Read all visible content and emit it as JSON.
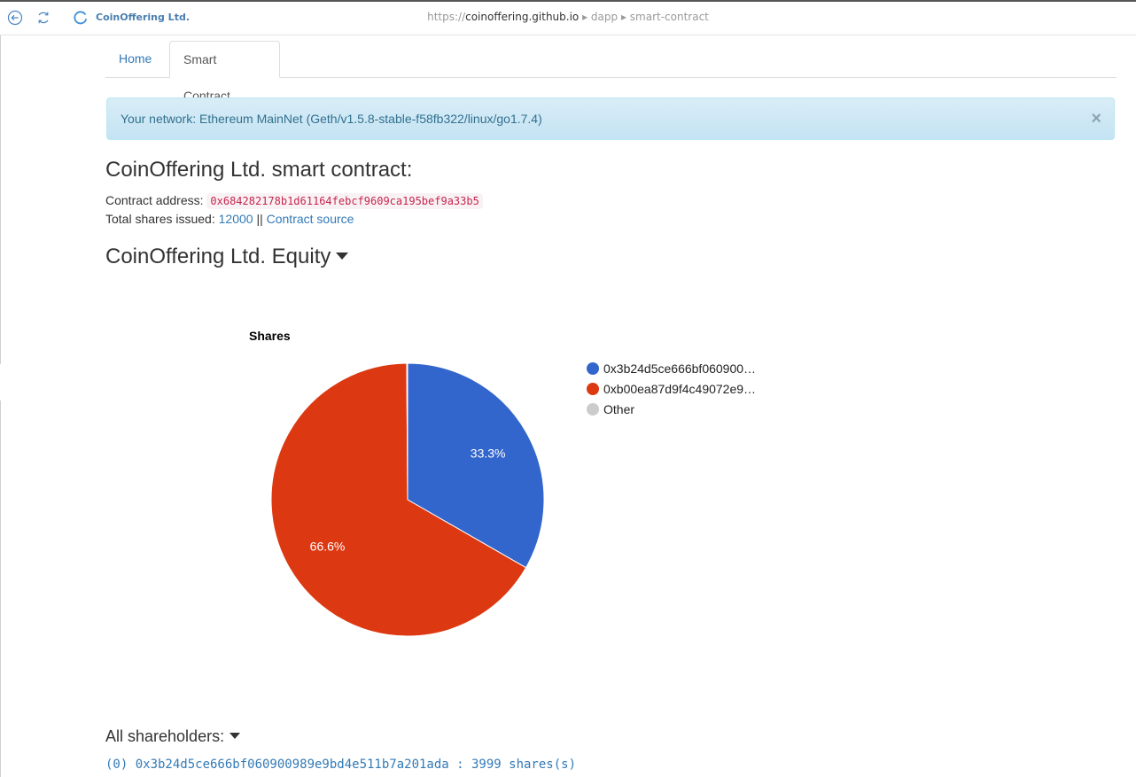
{
  "browser": {
    "tab_title": "CoinOffering Ltd.",
    "url_scheme": "https://",
    "url_host": "coinoffering.github.io",
    "url_path": " ▸ dapp ▸ smart-contract"
  },
  "tabs": [
    {
      "label": "Home",
      "active": false
    },
    {
      "label": "Smart Contract",
      "active": true
    }
  ],
  "alert": {
    "text": "Your network: Ethereum MainNet (Geth/v1.5.8-stable-f58fb322/linux/go1.7.4)",
    "close_label": "×"
  },
  "contract": {
    "title": "CoinOffering Ltd. smart contract:",
    "address_label": "Contract address:",
    "address": "0x684282178b1d61164febcf9609ca195bef9a33b5",
    "shares_label": "Total shares issued:",
    "total_shares": "12000",
    "separator": "||",
    "source_link": "Contract source"
  },
  "equity": {
    "heading": "CoinOffering Ltd. Equity"
  },
  "chart_data": {
    "type": "pie",
    "title": "Shares",
    "legend_position": "right",
    "series": [
      {
        "name": "0x3b24d5ce666bf060900…",
        "value": 33.3,
        "label": "33.3%",
        "color": "#3366cc"
      },
      {
        "name": "0xb00ea87d9f4c49072e9…",
        "value": 66.6,
        "label": "66.6%",
        "color": "#dc3912"
      },
      {
        "name": "Other",
        "value": 0.1,
        "label": "",
        "color": "#cccccc"
      }
    ]
  },
  "shareholders": {
    "heading": "All shareholders:",
    "items": [
      "(0) 0x3b24d5ce666bf060900989e9bd4e511b7a201ada : 3999 shares(s)"
    ]
  }
}
